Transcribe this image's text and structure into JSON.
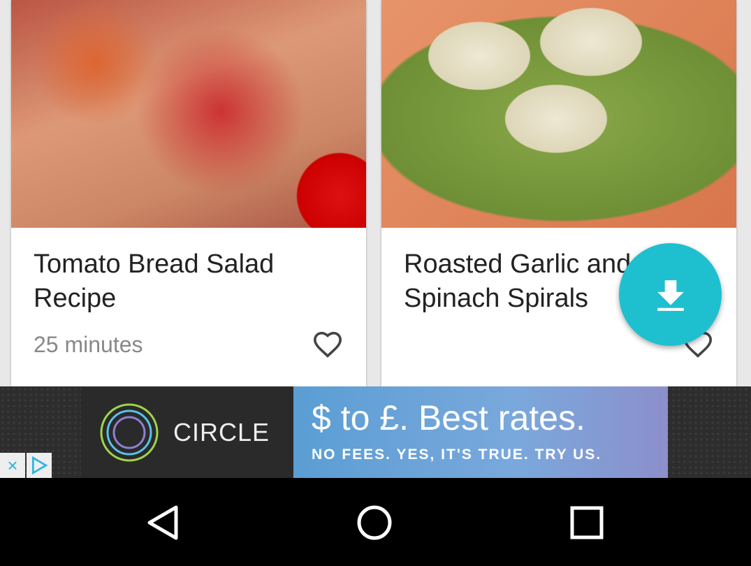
{
  "cards": [
    {
      "title": "Tomato Bread Salad Recipe",
      "time": "25 minutes",
      "favorite_icon": "heart-outline-icon"
    },
    {
      "title": "Roasted Garlic and Spinach Spirals",
      "time": "",
      "favorite_icon": "heart-outline-icon"
    }
  ],
  "fab": {
    "icon": "download-icon",
    "color": "#1ec0cf"
  },
  "ad": {
    "brand": "CIRCLE",
    "headline": "$ to £. Best rates.",
    "subline": "NO FEES. YES, IT'S TRUE. TRY US.",
    "close": "×"
  },
  "navbar": {
    "icons": [
      "back-icon",
      "home-icon",
      "recents-icon"
    ]
  }
}
